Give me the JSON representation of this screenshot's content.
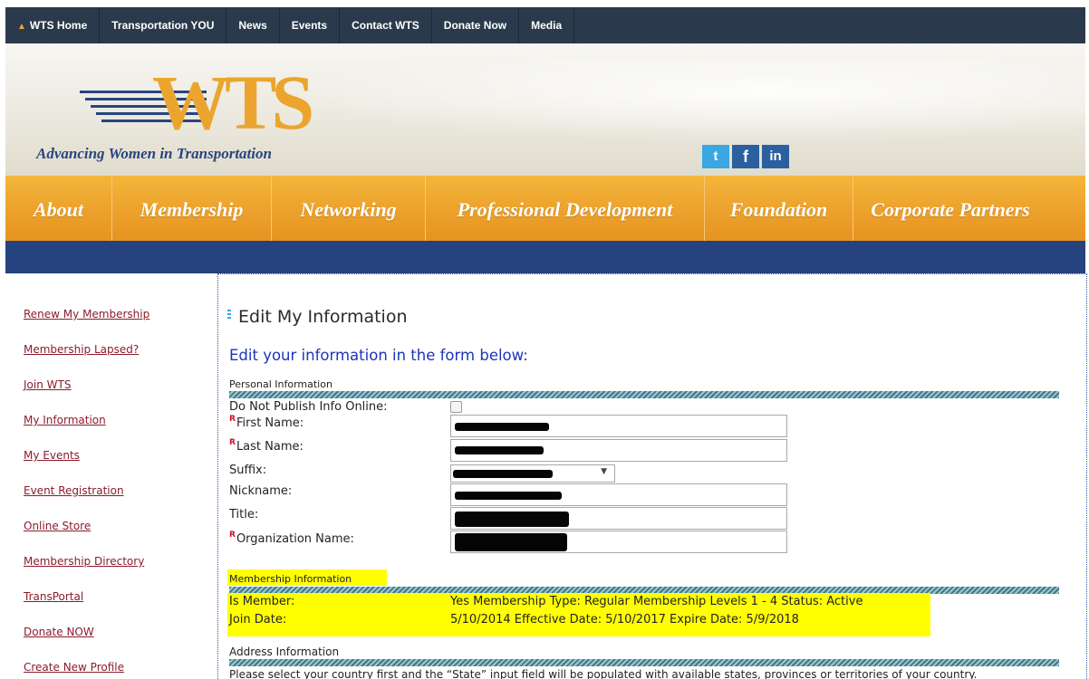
{
  "topnav": {
    "items": [
      "WTS Home",
      "Transportation YOU",
      "News",
      "Events",
      "Contact WTS",
      "Donate Now",
      "Media"
    ]
  },
  "header": {
    "logo_text": "WTS",
    "tagline": "Advancing Women in Transportation",
    "social": {
      "twitter": "t",
      "facebook": "f",
      "linkedin": "in"
    }
  },
  "mainnav": {
    "items": [
      "About",
      "Membership",
      "Networking",
      "Professional Development",
      "Foundation",
      "Corporate Partners"
    ]
  },
  "sidebar": {
    "items": [
      "Renew My Membership",
      "Membership Lapsed?",
      "Join WTS",
      "My Information",
      "My Events",
      "Event Registration",
      "Online Store",
      "Membership Directory",
      "TransPortal",
      "Donate NOW",
      "Create New Profile"
    ]
  },
  "main": {
    "title": "Edit My Information",
    "subtitle": "Edit your information in the form below:",
    "personal": {
      "heading": "Personal Information",
      "do_not_publish": "Do Not Publish Info Online:",
      "req_marker": "R",
      "first_name": "First Name:",
      "last_name": "Last Name:",
      "suffix": "Suffix:",
      "nickname": "Nickname:",
      "title": "Title:",
      "organization": "Organization Name:"
    },
    "membership": {
      "heading": "Membership Information",
      "is_member_label": "Is Member:",
      "is_member_value": "Yes  Membership Type:  Regular Membership Levels 1 - 4  Status:  Active",
      "join_date_label": "Join Date:",
      "join_date_value": "5/10/2014  Effective Date:  5/10/2017  Expire Date:  5/9/2018"
    },
    "address": {
      "heading": "Address Information",
      "note": "Please select your country first and the “State” input field will be populated with available states, provinces or territories of your country."
    }
  },
  "colors": {
    "topnav_bg": "#2a3a4c",
    "mainnav_orange": "#eca12c",
    "bluebar": "#24437f",
    "sidebar_link": "#8b1c2c",
    "subtitle_blue": "#1e35b8",
    "highlight": "#ffff00",
    "required": "#c8102e"
  }
}
